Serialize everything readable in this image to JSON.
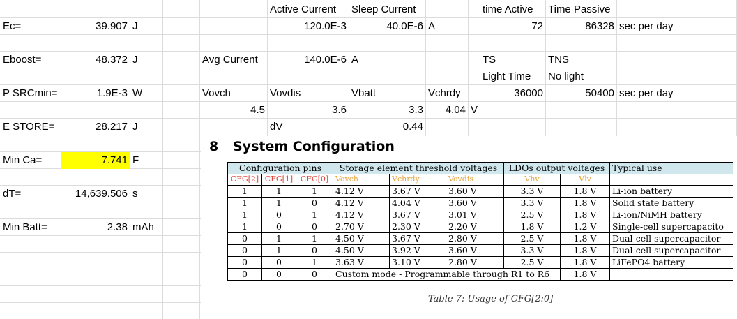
{
  "grid_cells": [
    {
      "id": "ec-label",
      "text": "Ec="
    },
    {
      "id": "ec-value",
      "text": "39.907"
    },
    {
      "id": "ec-unit",
      "text": "J"
    },
    {
      "id": "eboost-label",
      "text": "Eboost="
    },
    {
      "id": "eboost-value",
      "text": "48.372"
    },
    {
      "id": "eboost-unit",
      "text": "J"
    },
    {
      "id": "psrcmin-label",
      "text": "P SRCmin="
    },
    {
      "id": "psrcmin-value",
      "text": "1.9E-3"
    },
    {
      "id": "psrcmin-unit",
      "text": "W"
    },
    {
      "id": "estore-label",
      "text": "E STORE="
    },
    {
      "id": "estore-value",
      "text": "28.217"
    },
    {
      "id": "estore-unit",
      "text": "J"
    },
    {
      "id": "minca-label",
      "text": "Min Ca="
    },
    {
      "id": "minca-value",
      "text": "7.741"
    },
    {
      "id": "minca-unit",
      "text": "F"
    },
    {
      "id": "dt-label",
      "text": "dT="
    },
    {
      "id": "dt-value",
      "text": "14,639.506"
    },
    {
      "id": "dt-unit",
      "text": "s"
    },
    {
      "id": "minbatt-label",
      "text": "Min Batt="
    },
    {
      "id": "minbatt-value",
      "text": "2.38"
    },
    {
      "id": "minbatt-unit",
      "text": "mAh"
    },
    {
      "id": "active-current-header",
      "text": "Active Current"
    },
    {
      "id": "sleep-current-header",
      "text": "Sleep Current"
    },
    {
      "id": "active-current-value",
      "text": "120.0E-3"
    },
    {
      "id": "sleep-current-value",
      "text": "40.0E-6"
    },
    {
      "id": "current-unit",
      "text": "A"
    },
    {
      "id": "avg-current-label",
      "text": "Avg Current"
    },
    {
      "id": "avg-current-value",
      "text": "140.0E-6"
    },
    {
      "id": "avg-current-unit",
      "text": "A"
    },
    {
      "id": "vovch-header",
      "text": "Vovch"
    },
    {
      "id": "vovdis-header",
      "text": "Vovdis"
    },
    {
      "id": "vbatt-header",
      "text": "Vbatt"
    },
    {
      "id": "vchrdy-header",
      "text": "Vchrdy"
    },
    {
      "id": "vovch-value",
      "text": "4.5"
    },
    {
      "id": "vovdis-value",
      "text": "3.6"
    },
    {
      "id": "vbatt-value",
      "text": "3.3"
    },
    {
      "id": "vchrdy-value",
      "text": "4.04"
    },
    {
      "id": "voltage-unit",
      "text": "V"
    },
    {
      "id": "dv-label",
      "text": "dV"
    },
    {
      "id": "dv-value",
      "text": "0.44"
    },
    {
      "id": "time-active-header",
      "text": "time Active"
    },
    {
      "id": "time-passive-header",
      "text": "Time Passive"
    },
    {
      "id": "time-active-value",
      "text": "72"
    },
    {
      "id": "time-passive-value",
      "text": "86328"
    },
    {
      "id": "time-unit",
      "text": "sec per day"
    },
    {
      "id": "ts-label",
      "text": "TS"
    },
    {
      "id": "tns-label",
      "text": "TNS"
    },
    {
      "id": "light-time-label",
      "text": "Light Time"
    },
    {
      "id": "no-light-label",
      "text": "No light"
    },
    {
      "id": "light-time-value",
      "text": "36000"
    },
    {
      "id": "no-light-value",
      "text": "50400"
    },
    {
      "id": "light-time-unit",
      "text": "sec per day"
    }
  ],
  "highlight_color": "#ffff00",
  "pdf": {
    "section_number": "8",
    "section_title": "System Configuration",
    "group_headers": [
      "Configuration pins",
      "Storage element threshold voltages",
      "LDOs output voltages",
      "Typical use"
    ],
    "column_headers": [
      "CFG[2]",
      "CFG[1]",
      "CFG[0]",
      "Vovch",
      "Vchrdy",
      "Vovdis",
      "Vhv",
      "Vlv",
      ""
    ],
    "rows": [
      [
        "1",
        "1",
        "1",
        "4.12 V",
        "3.67 V",
        "3.60 V",
        "3.3 V",
        "1.8 V",
        "Li-ion battery"
      ],
      [
        "1",
        "1",
        "0",
        "4.12 V",
        "4.04 V",
        "3.60 V",
        "3.3 V",
        "1.8 V",
        "Solid state battery"
      ],
      [
        "1",
        "0",
        "1",
        "4.12 V",
        "3.67 V",
        "3.01 V",
        "2.5 V",
        "1.8 V",
        "Li-ion/NiMH battery"
      ],
      [
        "1",
        "0",
        "0",
        "2.70 V",
        "2.30 V",
        "2.20 V",
        "1.8 V",
        "1.2 V",
        "Single-cell supercapacito"
      ],
      [
        "0",
        "1",
        "1",
        "4.50 V",
        "3.67 V",
        "2.80 V",
        "2.5 V",
        "1.8 V",
        "Dual-cell supercapacitor"
      ],
      [
        "0",
        "1",
        "0",
        "4.50 V",
        "3.92 V",
        "3.60 V",
        "3.3 V",
        "1.8 V",
        "Dual-cell supercapacitor"
      ],
      [
        "0",
        "0",
        "1",
        "3.63 V",
        "3.10 V",
        "2.80 V",
        "2.5 V",
        "1.8 V",
        "LiFePO4 battery"
      ]
    ],
    "custom_row": {
      "pins": [
        "0",
        "0",
        "0"
      ],
      "text": "Custom mode - Programmable through R1 to R6",
      "vlv": "1.8 V"
    },
    "caption": "Table 7: Usage of CFG[2:0]",
    "header_bg": "#d0e8ed",
    "red_color": "#e0433a",
    "orange_color": "#e8a33c"
  }
}
